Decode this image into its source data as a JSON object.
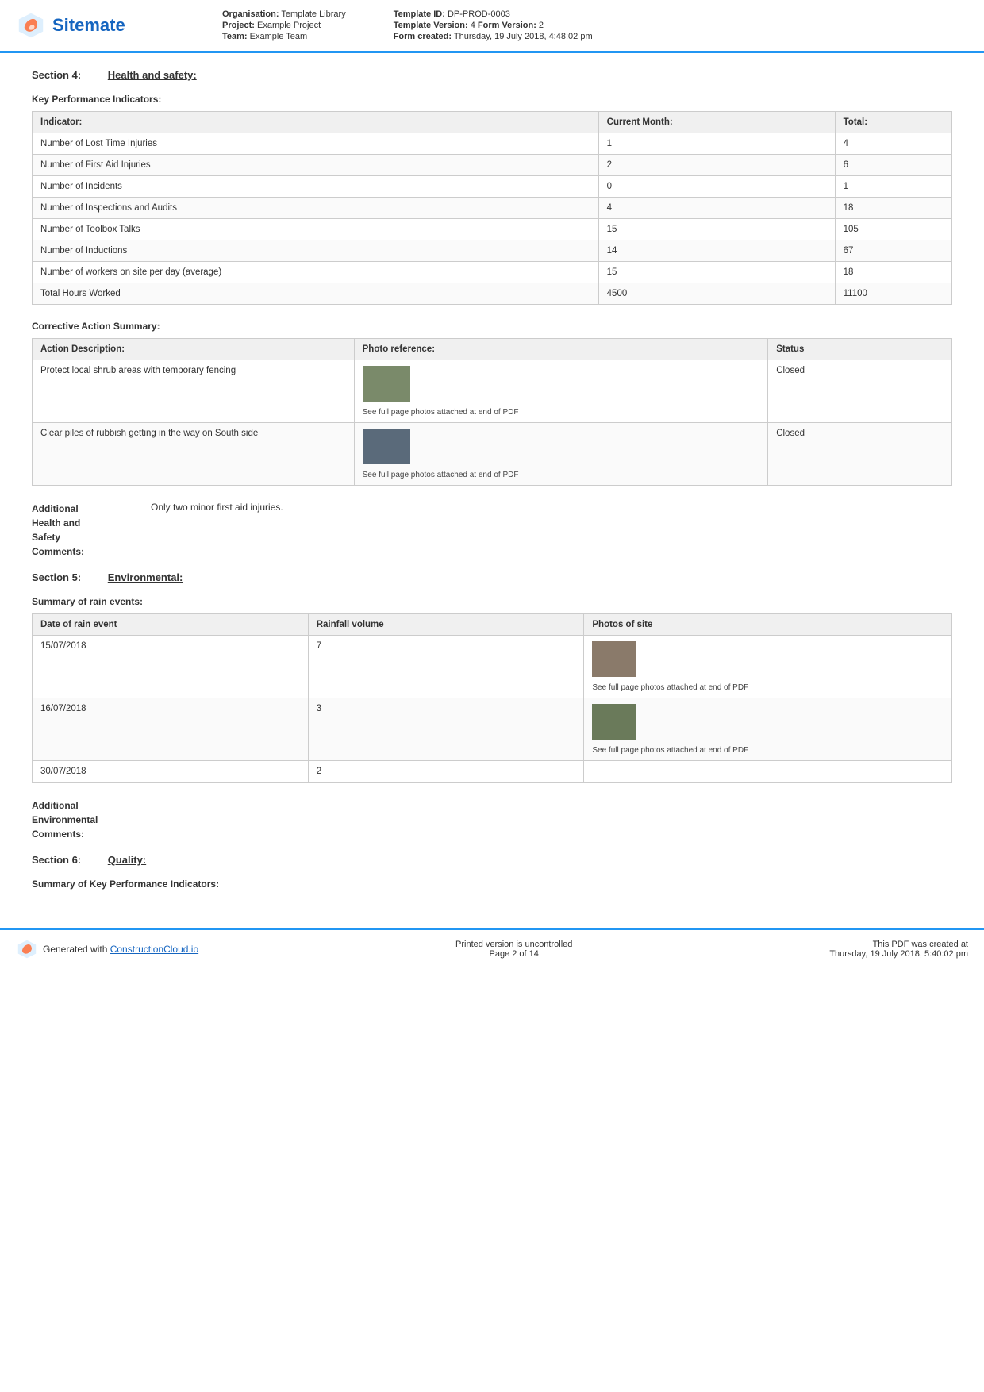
{
  "header": {
    "logo_text": "Sitemate",
    "org_label": "Organisation:",
    "org_value": "Template Library",
    "project_label": "Project:",
    "project_value": "Example Project",
    "team_label": "Team:",
    "team_value": "Example Team",
    "template_id_label": "Template ID:",
    "template_id_value": "DP-PROD-0003",
    "template_version_label": "Template Version:",
    "template_version_value": "4",
    "form_version_label": "Form Version:",
    "form_version_value": "2",
    "form_created_label": "Form created:",
    "form_created_value": "Thursday, 19 July 2018, 4:48:02 pm"
  },
  "section4": {
    "number": "Section 4:",
    "name": "Health and safety:"
  },
  "kpi_title": "Key Performance Indicators:",
  "kpi_table": {
    "headers": [
      "Indicator:",
      "Current Month:",
      "Total:"
    ],
    "rows": [
      [
        "Number of Lost Time Injuries",
        "1",
        "4"
      ],
      [
        "Number of First Aid Injuries",
        "2",
        "6"
      ],
      [
        "Number of Incidents",
        "0",
        "1"
      ],
      [
        "Number of Inspections and Audits",
        "4",
        "18"
      ],
      [
        "Number of Toolbox Talks",
        "15",
        "105"
      ],
      [
        "Number of Inductions",
        "14",
        "67"
      ],
      [
        "Number of workers on site per day (average)",
        "15",
        "18"
      ],
      [
        "Total Hours Worked",
        "4500",
        "11100"
      ]
    ]
  },
  "corrective_title": "Corrective Action Summary:",
  "corrective_table": {
    "headers": [
      "Action Description:",
      "Photo reference:",
      "Status"
    ],
    "rows": [
      {
        "description": "Protect local shrub areas with temporary fencing",
        "photo_caption": "See full page photos attached at end of PDF",
        "status": "Closed"
      },
      {
        "description": "Clear piles of rubbish getting in the way on South side",
        "photo_caption": "See full page photos attached at end of PDF",
        "status": "Closed"
      }
    ]
  },
  "additional_hs_label": "Additional\nHealth and\nSafety\nComments:",
  "additional_hs_value": "Only two minor first aid injuries.",
  "section5": {
    "number": "Section 5:",
    "name": "Environmental:"
  },
  "rain_title": "Summary of rain events:",
  "rain_table": {
    "headers": [
      "Date of rain event",
      "Rainfall volume",
      "Photos of site"
    ],
    "rows": [
      {
        "date": "15/07/2018",
        "volume": "7",
        "photo_caption": "See full page photos attached at end of PDF",
        "has_photo": true
      },
      {
        "date": "16/07/2018",
        "volume": "3",
        "photo_caption": "See full page photos attached at end of PDF",
        "has_photo": true
      },
      {
        "date": "30/07/2018",
        "volume": "2",
        "photo_caption": "",
        "has_photo": false
      }
    ]
  },
  "additional_env_label": "Additional\nEnvironmental\nComments:",
  "additional_env_value": "",
  "section6": {
    "number": "Section 6:",
    "name": "Quality:"
  },
  "quality_kpi_title": "Summary of Key Performance Indicators:",
  "footer": {
    "generated_label": "Generated with ",
    "generated_link": "ConstructionCloud.io",
    "center_line1": "Printed version is uncontrolled",
    "center_line2": "Page 2 of 14",
    "right_line1": "This PDF was created at",
    "right_line2": "Thursday, 19 July 2018, 5:40:02 pm"
  }
}
